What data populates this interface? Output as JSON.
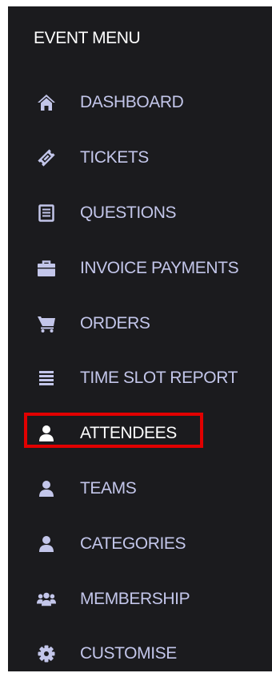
{
  "menu": {
    "title": "EVENT MENU",
    "items": [
      {
        "label": "DASHBOARD",
        "icon": "home-icon"
      },
      {
        "label": "TICKETS",
        "icon": "ticket-icon"
      },
      {
        "label": "QUESTIONS",
        "icon": "list-icon"
      },
      {
        "label": "INVOICE PAYMENTS",
        "icon": "briefcase-icon"
      },
      {
        "label": "ORDERS",
        "icon": "cart-icon"
      },
      {
        "label": "TIME SLOT REPORT",
        "icon": "bars-icon"
      },
      {
        "label": "ATTENDEES",
        "icon": "user-icon",
        "active": true
      },
      {
        "label": "TEAMS",
        "icon": "user-icon"
      },
      {
        "label": "CATEGORIES",
        "icon": "user-icon"
      },
      {
        "label": "MEMBERSHIP",
        "icon": "users-icon"
      },
      {
        "label": "CUSTOMISE",
        "icon": "gear-icon"
      }
    ]
  },
  "colors": {
    "panel_background": "#1b1b1e",
    "item_text": "#c3c6ea",
    "active_text": "#ffffff",
    "highlight_border": "#e10000"
  }
}
